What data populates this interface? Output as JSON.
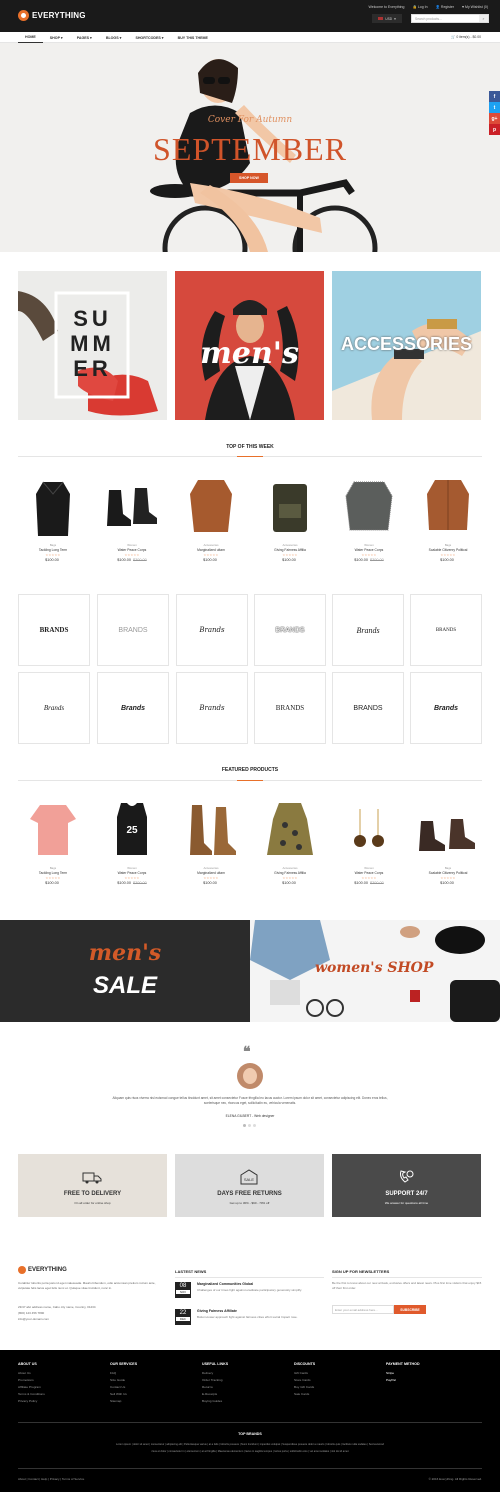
{
  "header": {
    "brand": "EVERYTHING",
    "welcome": "Welcome to Everything",
    "login": "Log In",
    "register": "Register",
    "wishlist": "My Wishlist (0)",
    "currency": "USD",
    "search_placeholder": "Search products..."
  },
  "nav": {
    "items": [
      "HOME",
      "SHOP ▾",
      "PAGES ▾",
      "BLOGS ▾",
      "SHORTCODES ▾",
      "BUY THIS THEME"
    ],
    "cart": "0 item(s) - $0.00"
  },
  "hero": {
    "script": "Cover For Autumn",
    "title": "SEPTEMBER",
    "button": "SHOP NOW"
  },
  "social": [
    "f",
    "t",
    "g+",
    "p"
  ],
  "banners": {
    "summer": [
      "SU",
      "MM",
      "ER"
    ],
    "mens": "men's",
    "accessories": "ACCESSORIES"
  },
  "top_week": {
    "title": "TOP OF THIS WEEK",
    "products": [
      {
        "cat": "Bags",
        "name": "Tackling Long Term",
        "price": "$100.00",
        "old": ""
      },
      {
        "cat": "Women",
        "name": "Water Peace Corps",
        "price": "$100.00",
        "old": "$300.00"
      },
      {
        "cat": "Accessories",
        "name": "Marginalized ultam",
        "price": "$100.00",
        "old": ""
      },
      {
        "cat": "Accessories",
        "name": "Giving Fairness Affilia",
        "price": "$100.00",
        "old": ""
      },
      {
        "cat": "Women",
        "name": "Water Peace Corps",
        "price": "$100.00",
        "old": "$300.00"
      },
      {
        "cat": "Bags",
        "name": "Scalable Citizenry Political",
        "price": "$100.00",
        "old": ""
      }
    ]
  },
  "brands": [
    "BRANDS",
    "BRANDS",
    "Brands",
    "BRANDS",
    "Brands",
    "BRANDS",
    "Brands",
    "Brands",
    "Brands",
    "BRANDS",
    "BRANDS",
    "Brands"
  ],
  "featured": {
    "title": "FEATURED PRODUCTS",
    "products": [
      {
        "cat": "Bags",
        "name": "Tackling Long Term",
        "price": "$100.00",
        "old": ""
      },
      {
        "cat": "Women",
        "name": "Water Peace Corps",
        "price": "$100.00",
        "old": "$300.00"
      },
      {
        "cat": "Accessories",
        "name": "Marginalized ultam",
        "price": "$100.00",
        "old": ""
      },
      {
        "cat": "Accessories",
        "name": "Giving Fairness Affilia",
        "price": "$100.00",
        "old": ""
      },
      {
        "cat": "Women",
        "name": "Water Peace Corps",
        "price": "$100.00",
        "old": "$300.00"
      },
      {
        "cat": "Bags",
        "name": "Scalable Citizenry Political",
        "price": "$100.00",
        "old": ""
      }
    ]
  },
  "sale": {
    "mens": "men's",
    "sale": "SALE",
    "womens": "women's SHOP"
  },
  "testimonial": {
    "text": "Aliquam quis risus viverra nisl euismod congue tellus tincidunt amet, sit amet consectetur Fusce fringilla leo lacus auctor. Lorem ipsum dolor sit amet, consectetur adipiscing elit. Donec eros tellus, scelerisque nec, rhoncus eget, sollicitudin eu, vehicula venenatis.",
    "author": "ELENA GILBERT - Web designer"
  },
  "services": [
    {
      "title": "FREE TO DELIVERY",
      "sub": "On all order for online shop"
    },
    {
      "title": "DAYS FREE RETURNS",
      "sub": "Get up to 30% - $90 - 70% off"
    },
    {
      "title": "SUPPORT 24/7",
      "sub": "We answer for questions all time"
    }
  ],
  "about": {
    "brand": "EVERYTHING",
    "text": "Curabitur lobortis porta justo id eget malesuada. Mauris bibendum, odio accumsan pretium rutrum ante, vulputate felis lacus eget felis nunc et. Quisque vitae tincidunt, nunc in.",
    "address": "23/47 abc address name, Cabo city name, Country, 01234",
    "phone": "(800) 123 456 7890",
    "email": "info@your-domain.com"
  },
  "news": {
    "title": "LASTEST NEWS",
    "items": [
      {
        "day": "08",
        "month": "NOV",
        "title": "Marginalized Communities Global",
        "text": "Challenges of our times fight against eradicate participatory generosity simplify."
      },
      {
        "day": "22",
        "month": "DEC",
        "title": "Giving Fairness Affiliate",
        "text": "Bottom-lower approach fight against fairness cities effort social Impact rose."
      }
    ]
  },
  "newsletter": {
    "title": "SIGN UP FOR NEWSLETTERS",
    "text": "Be the first to know about our new arrivals, exclusive offers and latest news. Plus first time visitors that enjoy $15 off their first order.",
    "placeholder": "Enter your email address here...",
    "button": "SUBSCRIBE"
  },
  "footer": {
    "columns": [
      {
        "title": "ABOUT US",
        "items": [
          "About Us",
          "Promotions",
          "Affiliate Program",
          "Terms & Conditions",
          "Privacy Policy"
        ]
      },
      {
        "title": "OUR SERVICES",
        "items": [
          "FAQ",
          "Size Guide",
          "Contact Us",
          "Sell With Us",
          "Sitemap"
        ]
      },
      {
        "title": "USEFUL LINKS",
        "items": [
          "Delivery",
          "Order Tracking",
          "Returns",
          "E-Receipts",
          "Buying Guides"
        ]
      },
      {
        "title": "DISCOUNTS",
        "items": [
          "Gift Cards",
          "Store Cards",
          "Buy Gift Cards",
          "Sale Cards"
        ]
      },
      {
        "title": "PAYMENT METHOD",
        "items": [
          "Stripe",
          "PayPal"
        ]
      }
    ],
    "top_brands_title": "TOP BRANDS",
    "top_brands_row1": "Lorem ipsum | dolor sit amet | consectetur | adipiscing elit | Pellentesque varius | at a felis | lobortis posuere | Nunc tincidunt | imperdiet volutpat | Suspendisse posuere dolor a mauris | lobortis quis | facilisis nulla sodales | Sed euismod",
    "top_brands_row2": "risus et dolor | consectetur in | elementum | at at fringilla | Maecenas elementum | lacus in sagittis tempus | luctus porta | sollicitudin eros | vel amet sodales | nisl dui id amet",
    "bottom_links": "About | Contact | Help | Privacy | Terms of Service",
    "copyright": "© 2016 Everything. All Rights Reserved."
  }
}
